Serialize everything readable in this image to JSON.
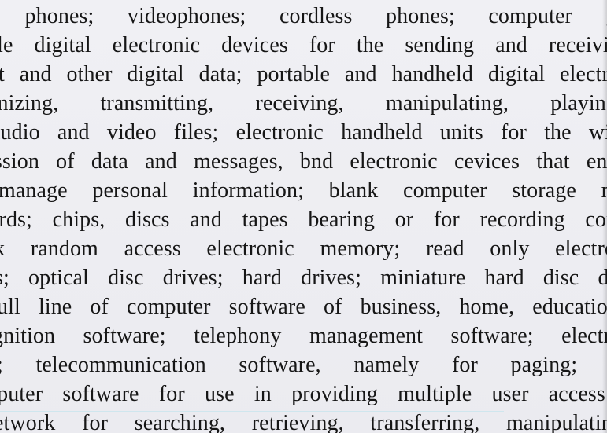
{
  "document": {
    "lines": [
      "s phones; videophones; cordless phones; computer gam",
      "ble digital electronic devices for the sending and receiving",
      "t and other digital data; portable and handheld digital electro",
      "anizing, transmitting, receiving, manipulating, playing",
      "audio and video files; electronic handheld units for the wire",
      "ission of data and messages, bnd electronic cevices that ena",
      "manage personal information; blank computer storage me",
      "ards; chips, discs and tapes bearing or for recording comp",
      "k random access electronic memory; read only electro",
      "s; optical disc drives; hard drives; miniature hard disc dr",
      "ull line of computer software of business, home, education",
      "gnition software; telephony management software; electro",
      "; telecommunication software, namely for paging; datab",
      "nputer software for use in providing multiple user access t",
      "etwork for searching, retrieving, transferring, manipulating"
    ]
  }
}
